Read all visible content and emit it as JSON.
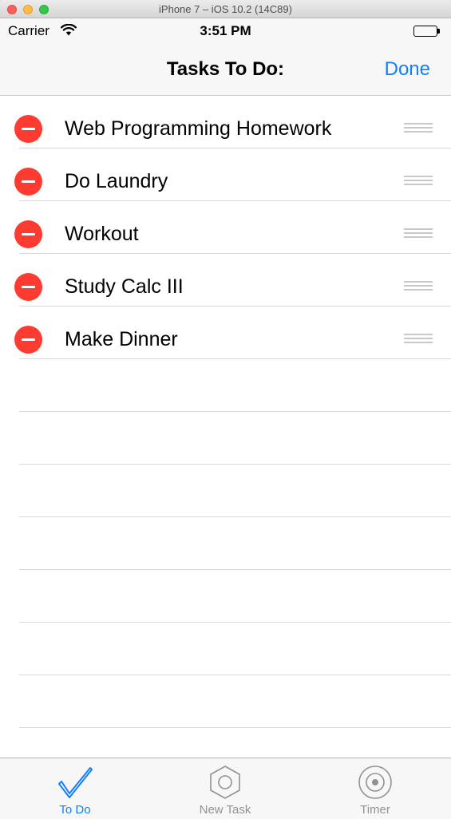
{
  "window": {
    "title": "iPhone 7 – iOS 10.2 (14C89)"
  },
  "status_bar": {
    "carrier": "Carrier",
    "time": "3:51 PM"
  },
  "nav_bar": {
    "title": "Tasks To Do:",
    "done_label": "Done"
  },
  "tasks": [
    {
      "label": "Web Programming Homework"
    },
    {
      "label": "Do Laundry"
    },
    {
      "label": "Workout"
    },
    {
      "label": "Study Calc III"
    },
    {
      "label": "Make Dinner"
    }
  ],
  "tab_bar": {
    "items": [
      {
        "label": "To Do",
        "icon": "checkmark-icon",
        "selected": true
      },
      {
        "label": "New Task",
        "icon": "hexagon-icon",
        "selected": false
      },
      {
        "label": "Timer",
        "icon": "timer-icon",
        "selected": false
      }
    ]
  },
  "colors": {
    "accent": "#157efb",
    "delete": "#fe3b30",
    "inactive": "#929292"
  }
}
